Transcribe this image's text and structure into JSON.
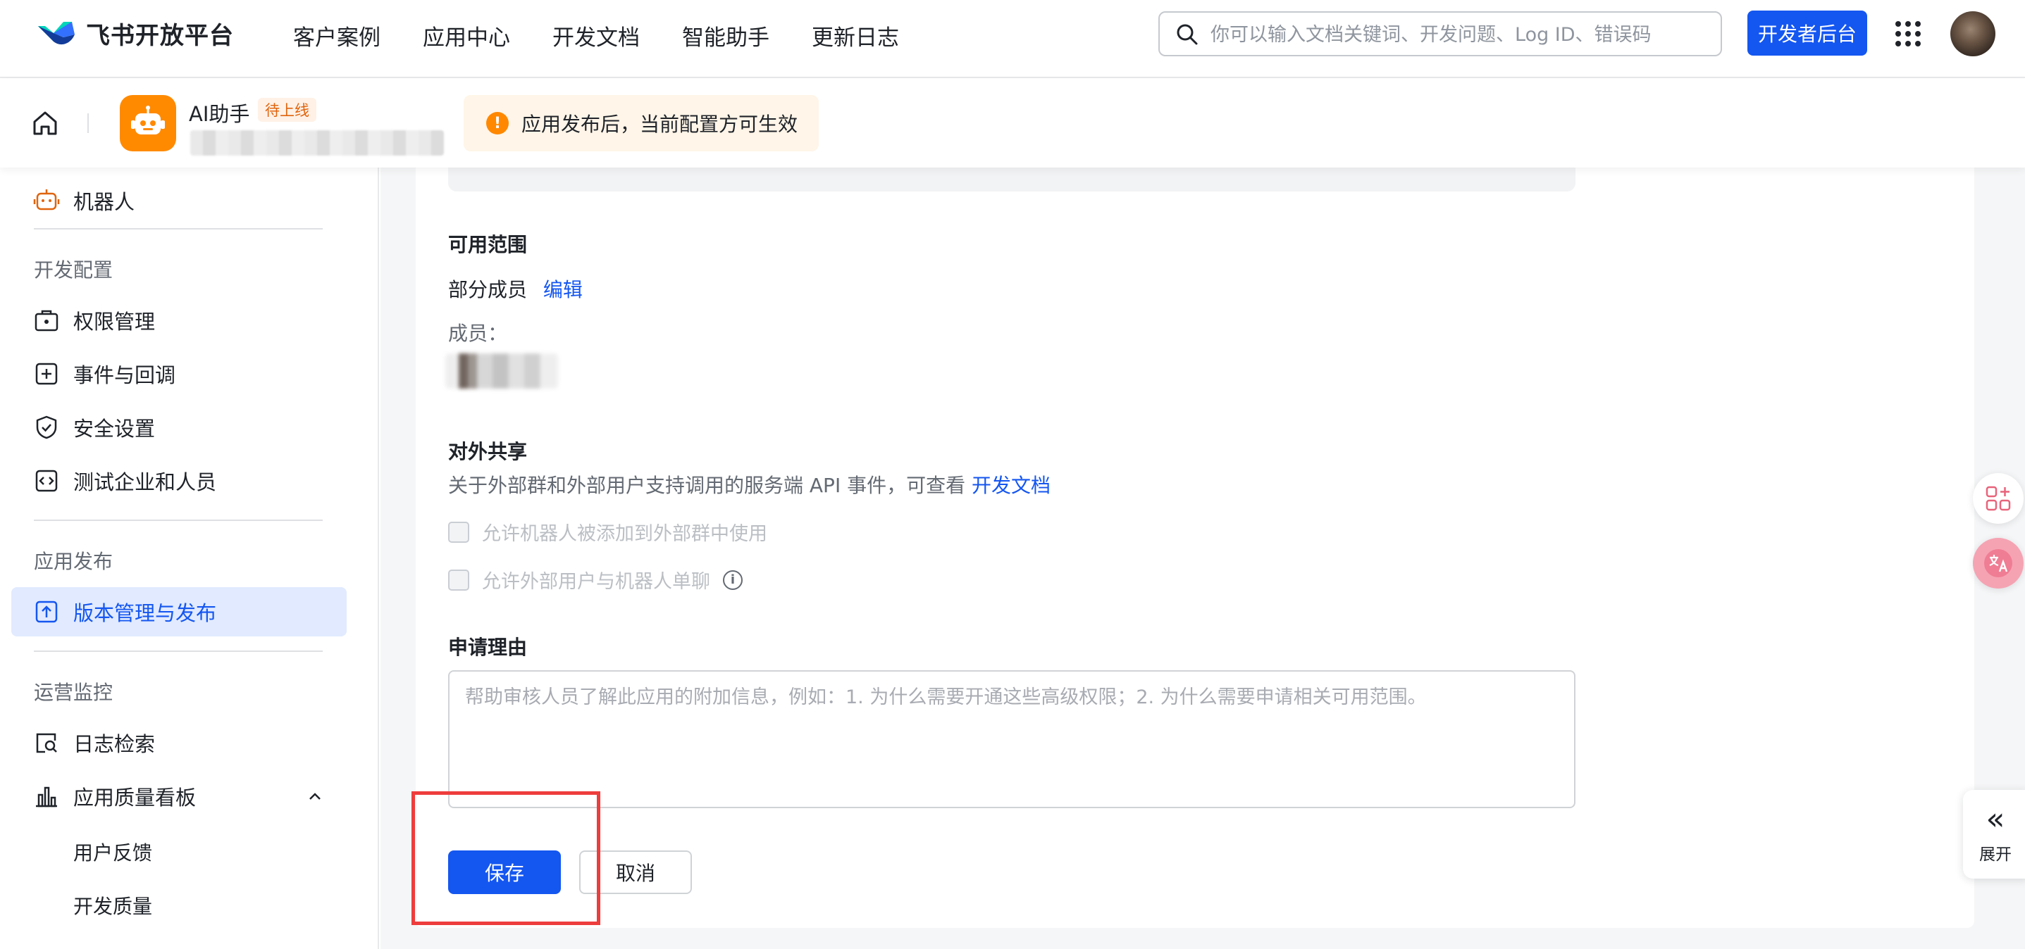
{
  "topnav": {
    "brand": "飞书开放平台",
    "items": [
      "客户案例",
      "应用中心",
      "开发文档",
      "智能助手",
      "更新日志"
    ],
    "search_placeholder": "你可以输入文档关键词、开发问题、Log ID、错误码",
    "dev_button": "开发者后台"
  },
  "subheader": {
    "app_name": "AI助手",
    "app_status": "待上线",
    "notice": "应用发布后，当前配置方可生效",
    "notice_icon": "!"
  },
  "sidebar": {
    "top_item": "机器人",
    "groups": [
      {
        "title": "开发配置",
        "items": [
          "权限管理",
          "事件与回调",
          "安全设置",
          "测试企业和人员"
        ]
      },
      {
        "title": "应用发布",
        "items": [
          "版本管理与发布"
        ]
      },
      {
        "title": "运营监控",
        "items": [
          "日志检索",
          "应用质量看板"
        ],
        "sub_items": [
          "用户反馈",
          "开发质量"
        ]
      }
    ],
    "active_item": "版本管理与发布"
  },
  "form": {
    "scope": {
      "title": "可用范围",
      "value": "部分成员",
      "edit_link": "编辑",
      "members_label": "成员："
    },
    "sharing": {
      "title": "对外共享",
      "desc": "关于外部群和外部用户支持调用的服务端 API 事件，可查看",
      "desc_link": "开发文档",
      "options": [
        "允许机器人被添加到外部群中使用",
        "允许外部用户与机器人单聊"
      ],
      "info_icon": "i"
    },
    "reason": {
      "title": "申请理由",
      "placeholder": "帮助审核人员了解此应用的附加信息，例如：1. 为什么需要开通这些高级权限；2. 为什么需要申请相关可用范围。"
    },
    "save_button": "保存",
    "cancel_button": "取消"
  },
  "right_panel": {
    "expand_label": "展开",
    "expand_icon": "«"
  }
}
